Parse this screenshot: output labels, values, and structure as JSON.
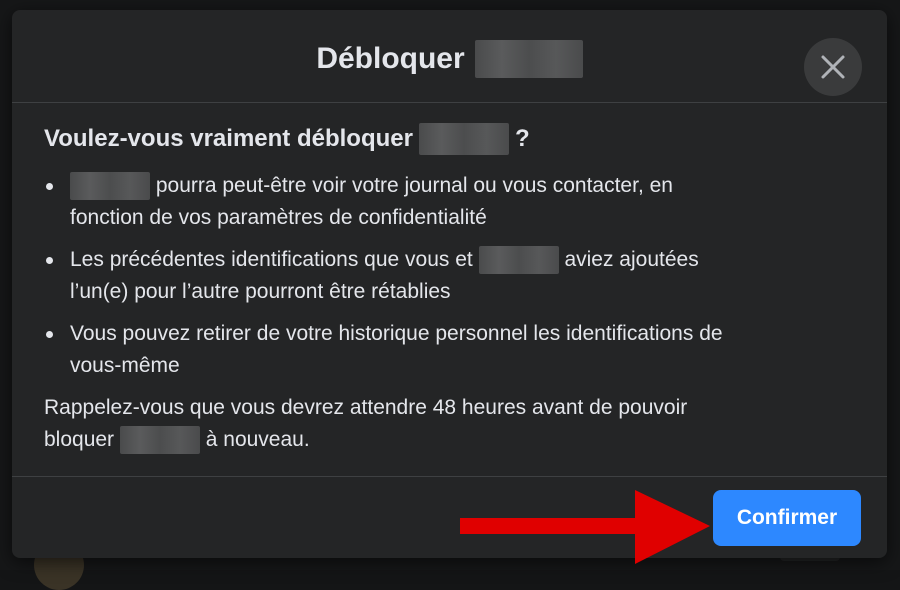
{
  "dialog": {
    "title": "Débloquer",
    "question_prefix": "Voulez-vous vraiment débloquer",
    "question_suffix": "?",
    "bullets": [
      {
        "after_name": "pourra peut-être voir votre journal ou vous contacter, en",
        "line2": "fonction de vos paramètres de confidentialité"
      },
      {
        "before_name": "Les précédentes identifications que vous et",
        "after_name": "aviez ajoutées",
        "line2": "l’un(e) pour l’autre pourront être rétablies"
      },
      {
        "line1": "Vous pouvez retirer de votre historique personnel les identifications de",
        "line2": "vous-même"
      }
    ],
    "note_line1": "Rappelez-vous que vous devrez attendre 48 heures avant de pouvoir",
    "note_before_name": "bloquer",
    "note_after_name": "à nouveau.",
    "confirm_label": "Confirmer",
    "close_icon": "close-icon"
  },
  "colors": {
    "dialog_bg": "#242526",
    "text": "#e4e6eb",
    "confirm_bg": "#2d88ff",
    "arrow": "#e00000"
  }
}
